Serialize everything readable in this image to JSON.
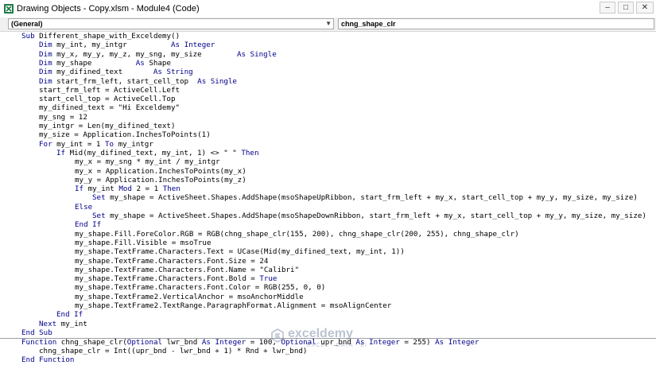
{
  "window": {
    "title": "Drawing Objects - Copy.xlsm - Module4 (Code)",
    "buttons": {
      "minimize": "–",
      "maximize": "□",
      "close": "✕"
    }
  },
  "combos": {
    "object": "(General)",
    "procedure": "chng_shape_clr"
  },
  "watermark": {
    "name": "exceldemy",
    "tagline": "EXCEL · DATA · BI"
  },
  "colors": {
    "keyword": "#00008b",
    "text": "#000000",
    "separator": "#9aa0a6"
  },
  "code": {
    "l0_kw0": "Sub",
    "l0_t0": " Different_shape_with_Exceldemy()",
    "l1_kw0": "Dim",
    "l1_t0": " my_int, my_intgr          ",
    "l1_kw1": "As Integer",
    "l2_kw0": "Dim",
    "l2_t0": " my_x, my_y, my_z, my_sng, my_size        ",
    "l2_kw1": "As Single",
    "l3_kw0": "Dim",
    "l3_t0": " my_shape          ",
    "l3_kw1": "As",
    "l3_t1": " Shape",
    "l4_kw0": "Dim",
    "l4_t0": " my_difined_text       ",
    "l4_kw1": "As String",
    "l5_kw0": "Dim",
    "l5_t0": " start_frm_left, start_cell_top  ",
    "l5_kw1": "As Single",
    "l6_t0": "start_frm_left = ActiveCell.Left",
    "l7_t0": "start_cell_top = ActiveCell.Top",
    "l8_t0": "my_difined_text = \"Hi Exceldemy\"",
    "l9_t0": "my_sng = 12",
    "l10_t0": "my_intgr = Len(my_difined_text)",
    "l11_t0": "my_size = Application.InchesToPoints(1)",
    "l12_kw0": "For",
    "l12_t0": " my_int = 1 ",
    "l12_kw1": "To",
    "l12_t1": " my_intgr",
    "l13_kw0": "If",
    "l13_t0": " Mid(my_difined_text, my_int, 1) <> \" \" ",
    "l13_kw1": "Then",
    "l14_t0": "my_x = my_sng * my_int / my_intgr",
    "l15_t0": "my_x = Application.InchesToPoints(my_x)",
    "l16_t0": "my_y = Application.InchesToPoints(my_z)",
    "l17_kw0": "If",
    "l17_t0": " my_int ",
    "l17_kw1": "Mod",
    "l17_t1": " 2 = 1 ",
    "l17_kw2": "Then",
    "l18_kw0": "Set",
    "l18_t0": " my_shape = ActiveSheet.Shapes.AddShape(msoShapeUpRibbon, start_frm_left + my_x, start_cell_top + my_y, my_size, my_size)",
    "l19_kw0": "Else",
    "l20_kw0": "Set",
    "l20_t0": " my_shape = ActiveSheet.Shapes.AddShape(msoShapeDownRibbon, start_frm_left + my_x, start_cell_top + my_y, my_size, my_size)",
    "l21_kw0": "End If",
    "l22_t0": "my_shape.Fill.ForeColor.RGB = RGB(chng_shape_clr(155, 200), chng_shape_clr(200, 255), chng_shape_clr)",
    "l23_t0": "my_shape.Fill.Visible = msoTrue",
    "l24_t0": "my_shape.TextFrame.Characters.Text = UCase(Mid(my_difined_text, my_int, 1))",
    "l25_t0": "my_shape.TextFrame.Characters.Font.Size = 24",
    "l26_t0": "my_shape.TextFrame.Characters.Font.Name = \"Calibri\"",
    "l27_t0": "my_shape.TextFrame.Characters.Font.Bold = ",
    "l27_kw0": "True",
    "l28_t0": "my_shape.TextFrame.Characters.Font.Color = RGB(255, 0, 0)",
    "l29_t0": "my_shape.TextFrame2.VerticalAnchor = msoAnchorMiddle",
    "l30_t0": "my_shape.TextFrame2.TextRange.ParagraphFormat.Alignment = msoAlignCenter",
    "l31_kw0": "End If",
    "l32_kw0": "Next",
    "l32_t0": " my_int",
    "l33_kw0": "End Sub",
    "l34_kw0": "Function",
    "l34_t0": " chng_shape_clr(",
    "l34_kw1": "Optional",
    "l34_t1": " lwr_bnd ",
    "l34_kw2": "As Integer",
    "l34_t2": " = 100, ",
    "l34_kw3": "Optional",
    "l34_t3": " upr_bnd ",
    "l34_kw4": "As Integer",
    "l34_t4": " = 255) ",
    "l34_kw5": "As Integer",
    "l35_t0": "chng_shape_clr = Int((upr_bnd - lwr_bnd + 1) * Rnd + lwr_bnd)",
    "l36_kw0": "End Function"
  }
}
